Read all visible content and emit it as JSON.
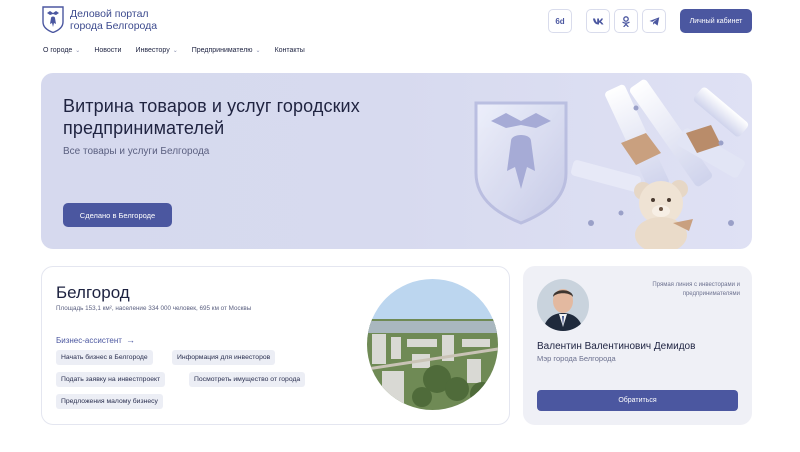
{
  "header": {
    "brand_line1": "Деловой портал",
    "brand_line2": "города Белгорода",
    "accessibility_label": "6d",
    "vk_label": "vk",
    "ok_label": "ok",
    "cabinet_label": "Личный кабинет"
  },
  "nav": {
    "items": [
      {
        "label": "О городе",
        "has_dropdown": true
      },
      {
        "label": "Новости",
        "has_dropdown": false
      },
      {
        "label": "Инвестору",
        "has_dropdown": true
      },
      {
        "label": "Предпринимателю",
        "has_dropdown": true
      },
      {
        "label": "Контакты",
        "has_dropdown": false
      }
    ]
  },
  "banner": {
    "title_line1": "Витрина товаров и услуг городских",
    "title_line2": "предпринимателей",
    "subtitle": "Все товары и услуги Белгорода",
    "button_label": "Сделано в Белгороде"
  },
  "city": {
    "title": "Белгород",
    "description": "Площадь 153,1 км², население 334 000 человек, 695 км от Москвы",
    "assistant_label": "Бизнес-ассистент",
    "chips": [
      "Начать бизнес в Белгороде",
      "Информация для инвесторов",
      "Подать заявку на инвестпроект",
      "Посмотреть имущество от города",
      "Предложения малому бизнесу"
    ]
  },
  "mayor": {
    "note": "Прямая линия с инвесторами и предпринимателями",
    "name": "Валентин Валентинович Демидов",
    "role": "Мэр города Белгорода",
    "button_label": "Обратиться"
  },
  "colors": {
    "accent": "#4b57a0",
    "banner_bg": "#d7daef",
    "card_bg": "#eff0f6",
    "chip_bg": "#eceef5"
  }
}
